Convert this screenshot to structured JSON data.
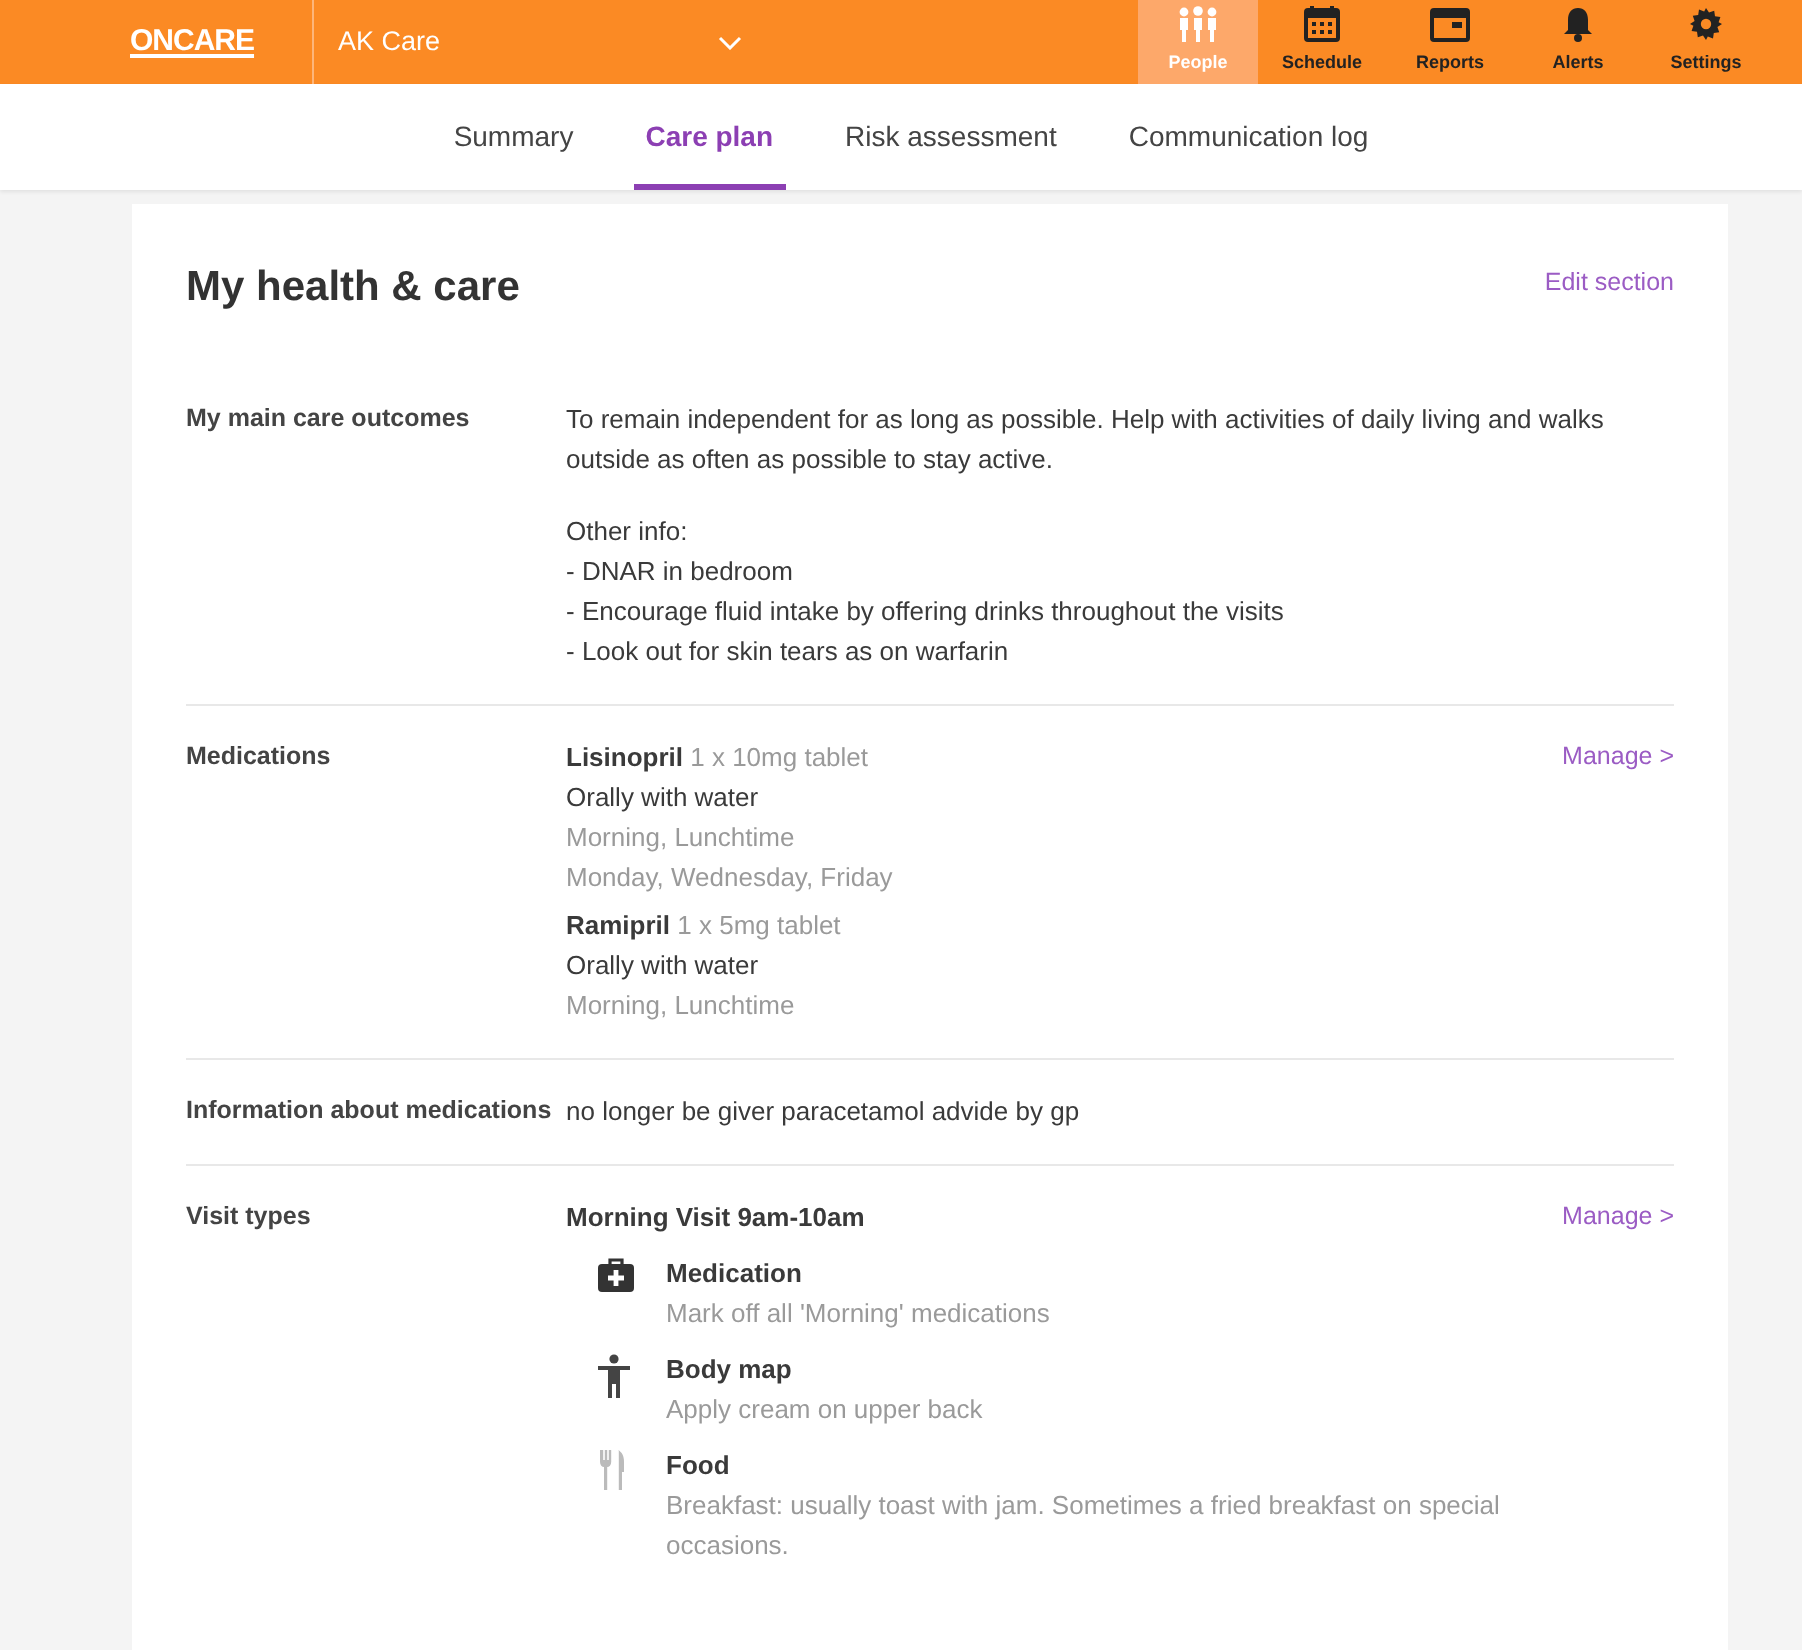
{
  "topbar": {
    "logo": "ONCARE",
    "account": "AK Care",
    "nav": [
      {
        "label": "People",
        "kind": "people",
        "selected": true
      },
      {
        "label": "Schedule",
        "kind": "calendar",
        "selected": false
      },
      {
        "label": "Reports",
        "kind": "folder",
        "selected": false
      },
      {
        "label": "Alerts",
        "kind": "bell",
        "selected": false
      },
      {
        "label": "Settings",
        "kind": "gear",
        "selected": false
      }
    ]
  },
  "tabs": [
    {
      "label": "Summary",
      "selected": false
    },
    {
      "label": "Care plan",
      "selected": true
    },
    {
      "label": "Risk assessment",
      "selected": false
    },
    {
      "label": "Communication log",
      "selected": false
    }
  ],
  "section": {
    "title": "My health & care",
    "edit_link": "Edit section",
    "rows": [
      {
        "kind": "text",
        "label": "My main care outcomes",
        "paragraphs": [
          [
            "To remain independent for as long as possible. Help with activities of daily living and walks outside as often as possible to stay active."
          ],
          [
            "Other info:",
            "- DNAR in bedroom",
            "- Encourage fluid intake by offering drinks throughout the visits",
            "- Look out for skin tears as on warfarin"
          ]
        ]
      },
      {
        "kind": "medications",
        "label": "Medications",
        "manage": "Manage >",
        "items": [
          {
            "name": "Lisinopril",
            "dose": "1 x 10mg tablet",
            "lines": [
              {
                "text": "Orally with water",
                "muted": false
              },
              {
                "text": "Morning, Lunchtime",
                "muted": true
              },
              {
                "text": "Monday, Wednesday, Friday",
                "muted": true
              }
            ]
          },
          {
            "name": "Ramipril",
            "dose": "1 x 5mg tablet",
            "lines": [
              {
                "text": "Orally with water",
                "muted": false
              },
              {
                "text": "Morning, Lunchtime",
                "muted": true
              }
            ]
          }
        ]
      },
      {
        "kind": "text",
        "label": "Information about medications",
        "paragraphs": [
          [
            "no longer be giver paracetamol advide by gp"
          ]
        ]
      },
      {
        "kind": "visits",
        "label": "Visit types",
        "manage": "Manage >",
        "visit": "Morning Visit 9am-10am",
        "tasks": [
          {
            "kind": "medication",
            "title": "Medication",
            "description": "Mark off all 'Morning' medications"
          },
          {
            "kind": "body",
            "title": "Body map",
            "description": "Apply cream on upper back"
          },
          {
            "kind": "food",
            "title": "Food",
            "description": "Breakfast: usually toast with jam. Sometimes a fried breakfast on special occasions."
          }
        ]
      }
    ]
  }
}
